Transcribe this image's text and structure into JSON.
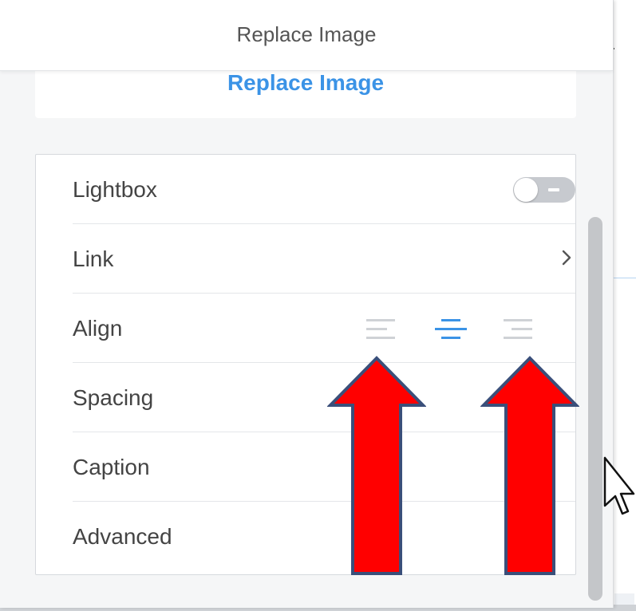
{
  "panel": {
    "title": "Replace Image",
    "replace_link": "Replace Image"
  },
  "settings": {
    "rows": [
      {
        "label": "Lightbox",
        "control": "toggle",
        "toggle_on": false
      },
      {
        "label": "Link",
        "control": "chevron-right-icon"
      },
      {
        "label": "Align",
        "control": "align-group",
        "selected": "center"
      },
      {
        "label": "Spacing"
      },
      {
        "label": "Caption"
      },
      {
        "label": "Advanced"
      }
    ]
  },
  "colors": {
    "accent": "#3b93e6",
    "annotation_arrow": "#ff0000",
    "annotation_border": "#3a4f7a"
  },
  "annotations": {
    "arrows": [
      "arrow-up-red",
      "arrow-up-red"
    ]
  }
}
